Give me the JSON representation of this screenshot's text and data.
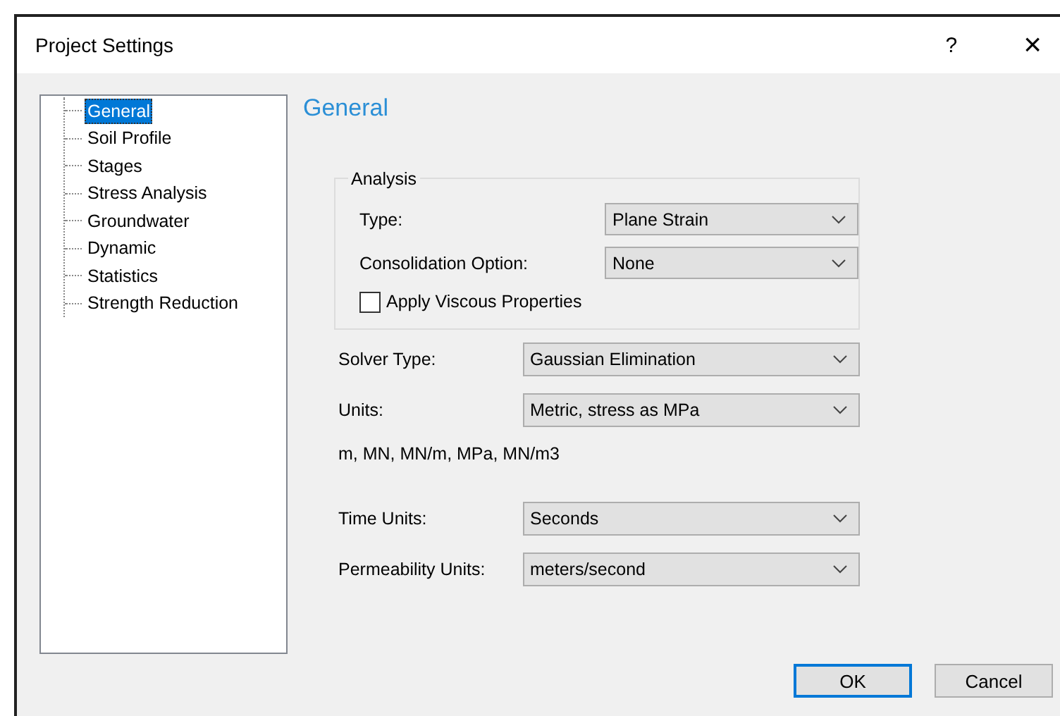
{
  "window": {
    "title": "Project Settings",
    "help": "?",
    "close": "×"
  },
  "tree": {
    "items": [
      {
        "label": "General",
        "selected": true
      },
      {
        "label": "Soil Profile",
        "selected": false
      },
      {
        "label": "Stages",
        "selected": false
      },
      {
        "label": "Stress Analysis",
        "selected": false
      },
      {
        "label": "Groundwater",
        "selected": false
      },
      {
        "label": "Dynamic",
        "selected": false
      },
      {
        "label": "Statistics",
        "selected": false
      },
      {
        "label": "Strength Reduction",
        "selected": false
      }
    ]
  },
  "page": {
    "heading": "General",
    "analysis": {
      "title": "Analysis",
      "fields": [
        {
          "label": "Type:",
          "value": "Plane Strain"
        },
        {
          "label": "Consolidation Option:",
          "value": "None"
        }
      ],
      "checkbox": {
        "label": "Apply Viscous Properties",
        "checked": false
      }
    },
    "fields": [
      {
        "label": "Solver Type:",
        "value": "Gaussian Elimination"
      },
      {
        "label": "Units:",
        "value": "Metric, stress as MPa"
      }
    ],
    "units_note": "m, MN, MN/m, MPa, MN/m3",
    "time_fields": [
      {
        "label": "Time Units:",
        "value": "Seconds"
      },
      {
        "label": "Permeability Units:",
        "value": "meters/second"
      }
    ]
  },
  "buttons": [
    {
      "label": "OK",
      "default": true
    },
    {
      "label": "Cancel",
      "default": false
    }
  ]
}
